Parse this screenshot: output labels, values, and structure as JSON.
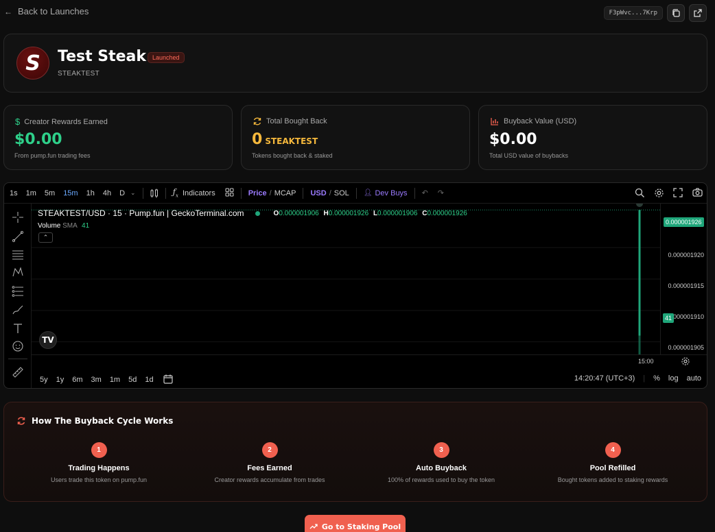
{
  "nav": {
    "back_label": "Back to Launches",
    "address": "F3pWvc...7Krp"
  },
  "token": {
    "name": "Test Steak",
    "badge": "Launched",
    "ticker": "STEAKTEST",
    "logo_letter": "S"
  },
  "stats": [
    {
      "label": "Creator Rewards Earned",
      "value": "$0.00",
      "unit": "",
      "sub": "From pump.fun trading fees",
      "color": "#2ed08a",
      "icon": "dollar-icon"
    },
    {
      "label": "Total Bought Back",
      "value": "0",
      "unit": "STEAKTEST",
      "sub": "Tokens bought back & staked",
      "color": "#f5b83c",
      "icon": "refresh-icon"
    },
    {
      "label": "Buyback Value (USD)",
      "value": "$0.00",
      "unit": "",
      "sub": "Total USD value of buybacks",
      "color": "#ffffff",
      "icon": "bar-chart-icon"
    }
  ],
  "chart": {
    "timeframes": [
      "1s",
      "1m",
      "5m",
      "15m",
      "1h",
      "4h",
      "D"
    ],
    "active_timeframe": "15m",
    "indicators_label": "Indicators",
    "price_label": "Price",
    "mcap_label": "MCAP",
    "usd_label": "USD",
    "sol_label": "SOL",
    "dev_buys_label": "Dev Buys",
    "symbol": "STEAKTEST/USD · 15 · Pump.fun | GeckoTerminal.com",
    "o_label": "O",
    "o_value": "0.000001906",
    "h_label": "H",
    "h_value": "0.000001926",
    "l_label": "L",
    "l_value": "0.000001906",
    "c_label": "C",
    "c_value": "0.000001926",
    "volume_label": "Volume",
    "sma_label": "SMA",
    "sma_value": "41",
    "price_ticks": [
      "0.000001920",
      "0.000001915",
      "0.000001910",
      "0.000001905"
    ],
    "current_price": "0.000001926",
    "volume_tag": "41",
    "time_label": "15:00",
    "ranges": [
      "5y",
      "1y",
      "6m",
      "3m",
      "1m",
      "5d",
      "1d"
    ],
    "clock": "14:20:47 (UTC+3)",
    "pct_label": "%",
    "log_label": "log",
    "auto_label": "auto",
    "tv_logo": "TV"
  },
  "chart_data": {
    "type": "bar",
    "title": "STEAKTEST/USD · 15 · Pump.fun | GeckoTerminal.com",
    "xlabel": "",
    "ylabel": "",
    "x": [
      "15:00"
    ],
    "series": [
      {
        "name": "Volume",
        "values": [
          41
        ]
      }
    ],
    "candle": {
      "open": 1.906e-06,
      "high": 1.926e-06,
      "low": 1.906e-06,
      "close": 1.926e-06
    },
    "ylim": [
      1.903e-06,
      1.927e-06
    ],
    "grid": true,
    "accent": "#1fa67a"
  },
  "cycle": {
    "title": "How The Buyback Cycle Works",
    "steps": [
      {
        "num": "1",
        "title": "Trading Happens",
        "desc": "Users trade this token on pump.fun"
      },
      {
        "num": "2",
        "title": "Fees Earned",
        "desc": "Creator rewards accumulate from trades"
      },
      {
        "num": "3",
        "title": "Auto Buyback",
        "desc": "100% of rewards used to buy the token"
      },
      {
        "num": "4",
        "title": "Pool Refilled",
        "desc": "Bought tokens added to staking rewards"
      }
    ]
  },
  "cta": {
    "label": "Go to Staking Pool"
  }
}
